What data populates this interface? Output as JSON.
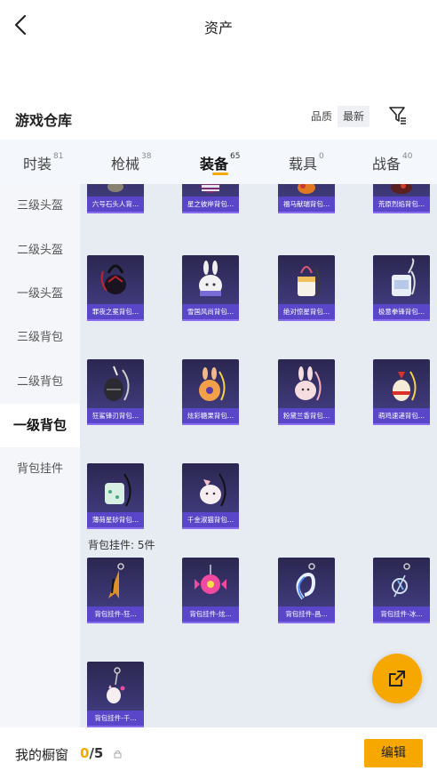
{
  "header": {
    "title": "资产"
  },
  "warehouse": {
    "title": "游戏仓库",
    "sort_options": [
      "品质",
      "最新"
    ],
    "active_sort": "最新"
  },
  "tabs": [
    {
      "label": "时装",
      "count": "81"
    },
    {
      "label": "枪械",
      "count": "38"
    },
    {
      "label": "装备",
      "count": "65",
      "active": true
    },
    {
      "label": "载具",
      "count": "0"
    },
    {
      "label": "战备",
      "count": "40"
    }
  ],
  "sidebar": [
    {
      "label": "三级头盔"
    },
    {
      "label": "二级头盔"
    },
    {
      "label": "一级头盔"
    },
    {
      "label": "三级背包"
    },
    {
      "label": "二级背包"
    },
    {
      "label": "一级背包",
      "active": true
    },
    {
      "label": "背包挂件"
    }
  ],
  "items_row0": [
    "六号石头人背...",
    "星之彼岸背包...",
    "福马献瑞背包...",
    "荒原烈焰背包..."
  ],
  "items_row1": [
    "罪夜之冕背包...",
    "雪国风尚背包...",
    "绝对惊星背包...",
    "极意拳锋背包..."
  ],
  "items_row2": [
    "狂鲨锋刃背包...",
    "炫彩糖果背包...",
    "粉黛兰香背包...",
    "萌鸡速递背包..."
  ],
  "items_row3": [
    "薄荷星砂背包...",
    "千金淑猫背包..."
  ],
  "section_pendants": "背包挂件: 5件",
  "pendants_row0": [
    "背包挂件-狂...",
    "背包挂件-炫...",
    "背包挂件-昌...",
    "背包挂件-冰..."
  ],
  "pendants_row1": [
    "背包挂件-千..."
  ],
  "bottom": {
    "label": "我的橱窗",
    "current": "0",
    "total": "/5",
    "edit_label": "编辑"
  },
  "colors": {
    "accent": "#f6a800",
    "card_label": "#5946c8",
    "sidebar_bg": "#f4f6fa"
  }
}
